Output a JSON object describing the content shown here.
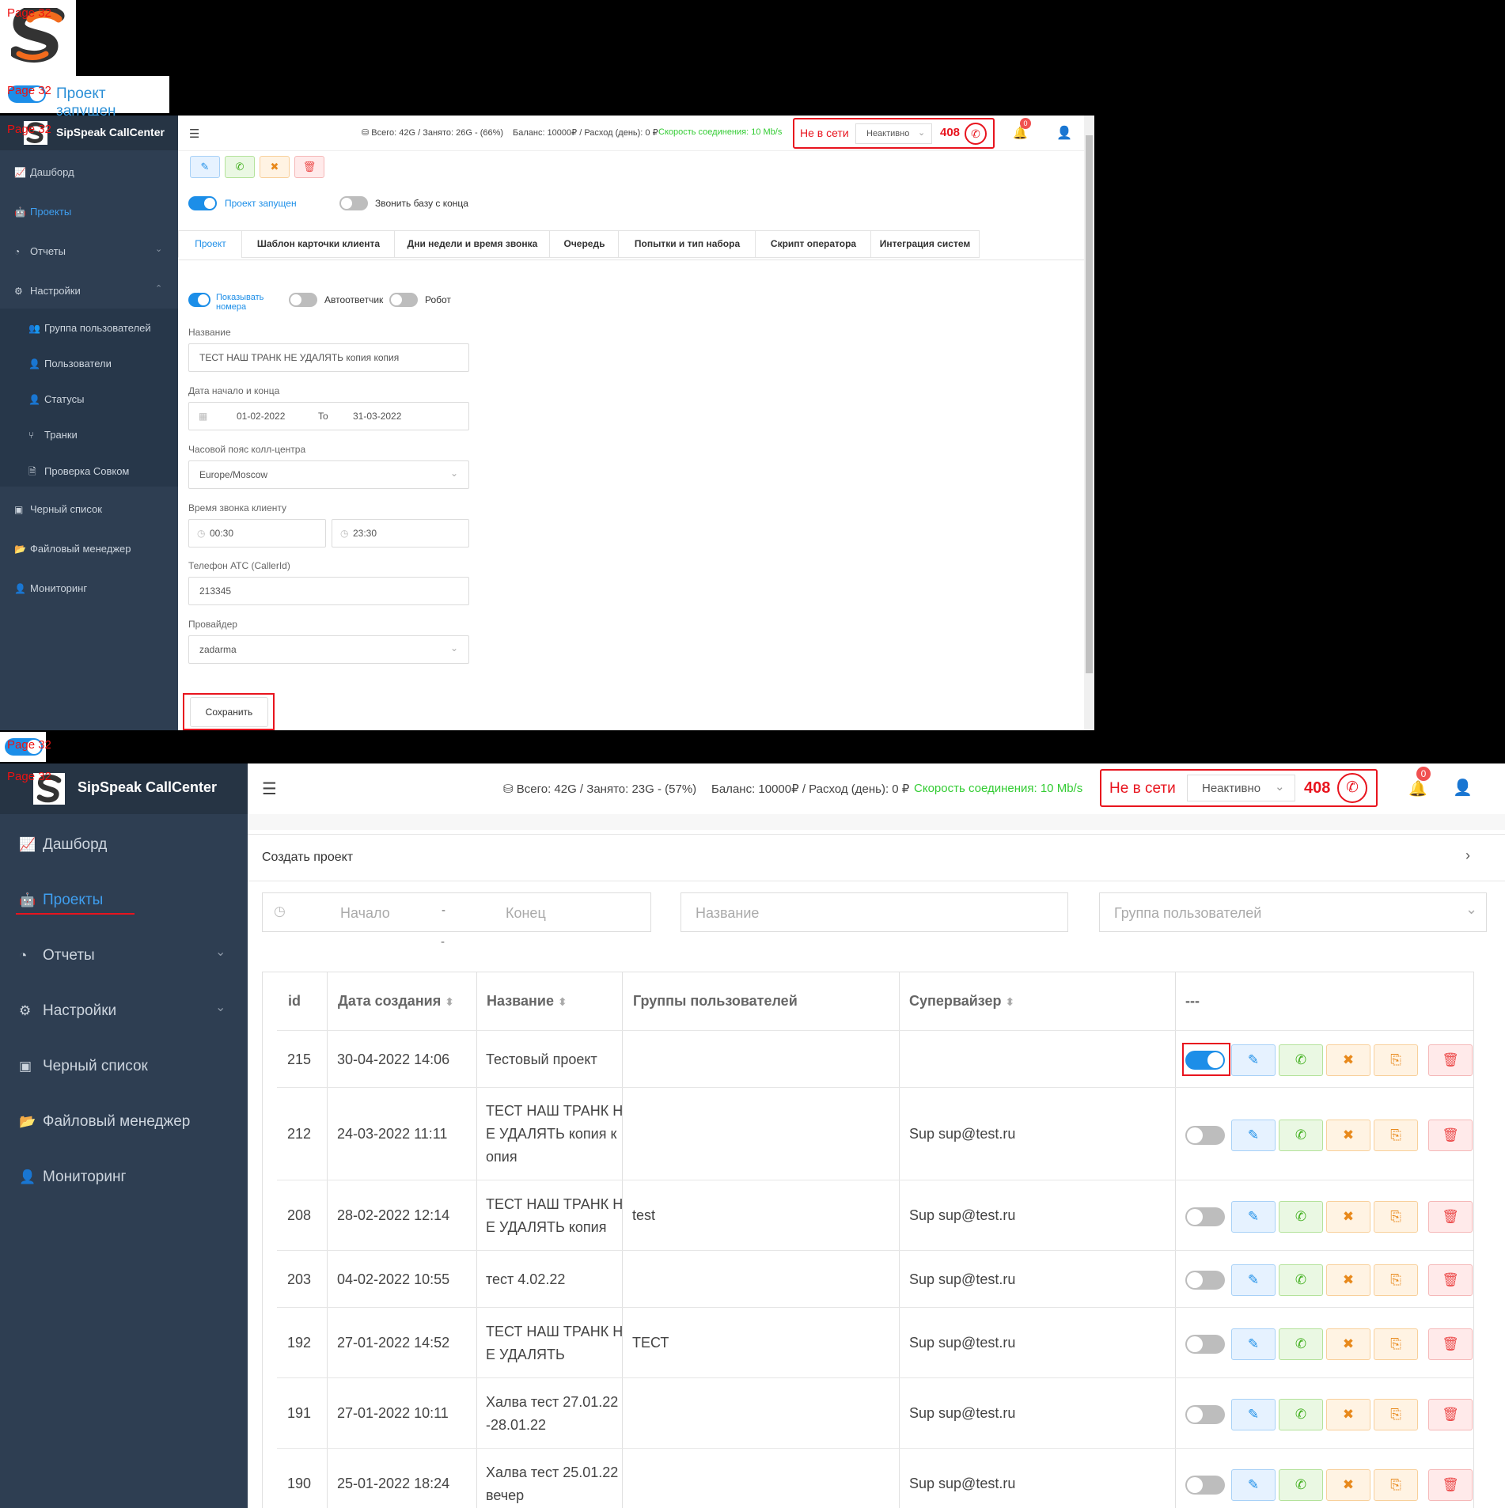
{
  "page_label": "Page 32",
  "logo": {
    "letter": "S"
  },
  "project_running_label": "Проект запущен",
  "colors": {
    "sidebar": "#2e3e52",
    "brand_bar": "#263444",
    "accent": "#1c8ee8",
    "offline_red": "#e8141e",
    "speed_green": "#33cc33"
  },
  "top": {
    "brand": "SipSpeak CallCenter",
    "nav": [
      {
        "label": "Дашборд",
        "icon": "chart-icon"
      },
      {
        "label": "Проекты",
        "icon": "robot-icon"
      },
      {
        "label": "Отчеты",
        "icon": "pie-chart-icon"
      },
      {
        "label": "Настройки",
        "icon": "gear-icon"
      },
      {
        "label": "Группа пользователей",
        "icon": "users-icon"
      },
      {
        "label": "Пользователи",
        "icon": "user-icon"
      },
      {
        "label": "Статусы",
        "icon": "user-status-icon"
      },
      {
        "label": "Транки",
        "icon": "sitemap-icon"
      },
      {
        "label": "Проверка Совком",
        "icon": "file-check-icon"
      },
      {
        "label": "Черный список",
        "icon": "blacklist-icon"
      },
      {
        "label": "Файловый менеджер",
        "icon": "folder-icon"
      },
      {
        "label": "Мониторинг",
        "icon": "monitor-user-icon"
      }
    ],
    "header": {
      "storage": "Всего: 42G / Занято: 26G - (66%)",
      "balance": "Баланс: 10000₽ / Расход (день): 0 ₽",
      "speed": "Скорость соединения: 10 Mb/s",
      "offline": "Не в сети",
      "status_select": "Неактивно",
      "ext": "408",
      "notif_count": "0"
    },
    "toggle_running": "Проект запущен",
    "toggle_reverse": "Звонить базу с конца",
    "tabs": [
      "Проект",
      "Шаблон карточки клиента",
      "Дни недели и время звонка",
      "Очередь",
      "Попытки и тип набора",
      "Скрипт оператора",
      "Интеграция систем"
    ],
    "toggle_show_numbers": "Показывать номера",
    "toggle_answering": "Автоответчик",
    "toggle_robot": "Робот",
    "form": {
      "name_label": "Название",
      "name_value": "ТЕСТ НАШ ТРАНК НЕ УДАЛЯТЬ копия копия",
      "dates_label": "Дата начало и конца",
      "date_start": "01-02-2022",
      "date_to": "To",
      "date_end": "31-03-2022",
      "tz_label": "Часовой пояс колл-центра",
      "tz_value": "Europe/Moscow",
      "call_time_label": "Время звонка клиенту",
      "time_from": "00:30",
      "time_to": "23:30",
      "callerid_label": "Телефон АТС (CallerId)",
      "callerid_value": "213345",
      "provider_label": "Провайдер",
      "provider_value": "zadarma",
      "save": "Сохранить"
    }
  },
  "bottom": {
    "brand": "SipSpeak CallCenter",
    "nav": [
      {
        "label": "Дашборд",
        "icon": "chart-icon"
      },
      {
        "label": "Проекты",
        "icon": "robot-icon"
      },
      {
        "label": "Отчеты",
        "icon": "pie-chart-icon"
      },
      {
        "label": "Настройки",
        "icon": "gear-icon"
      },
      {
        "label": "Черный список",
        "icon": "blacklist-icon"
      },
      {
        "label": "Файловый менеджер",
        "icon": "folder-icon"
      },
      {
        "label": "Мониторинг",
        "icon": "monitor-user-icon"
      }
    ],
    "header": {
      "storage": "Всего: 42G / Занято: 23G - (57%)",
      "balance": "Баланс: 10000₽ / Расход (день): 0 ₽",
      "speed": "Скорость соединения: 10 Mb/s",
      "offline": "Не в сети",
      "status_select": "Неактивно",
      "ext": "408",
      "notif_count": "0"
    },
    "create_project": "Создать проект",
    "filters": {
      "start": "Начало",
      "dash": "-",
      "end": "Конец",
      "name": "Название",
      "group": "Группа пользователей"
    },
    "table": {
      "headers": [
        "id",
        "Дата создания",
        "Название",
        "Группы пользователей",
        "Супервайзер",
        "---"
      ],
      "rows": [
        {
          "id": "215",
          "date": "30-04-2022 14:06",
          "name": [
            "Тестовый проект"
          ],
          "group": "",
          "sup": "",
          "on": true
        },
        {
          "id": "212",
          "date": "24-03-2022 11:11",
          "name": [
            "ТЕСТ НАШ ТРАНК Н",
            "Е УДАЛЯТЬ копия к",
            "опия"
          ],
          "group": "",
          "sup": "Sup sup@test.ru",
          "on": false
        },
        {
          "id": "208",
          "date": "28-02-2022 12:14",
          "name": [
            "ТЕСТ НАШ ТРАНК Н",
            "Е УДАЛЯТЬ копия"
          ],
          "group": "test",
          "sup": "Sup sup@test.ru",
          "on": false
        },
        {
          "id": "203",
          "date": "04-02-2022 10:55",
          "name": [
            "тест 4.02.22"
          ],
          "group": "",
          "sup": "Sup sup@test.ru",
          "on": false
        },
        {
          "id": "192",
          "date": "27-01-2022 14:52",
          "name": [
            "ТЕСТ НАШ ТРАНК Н",
            "Е УДАЛЯТЬ"
          ],
          "group": "ТЕСТ",
          "sup": "Sup sup@test.ru",
          "on": false
        },
        {
          "id": "191",
          "date": "27-01-2022 10:11",
          "name": [
            "Халва тест 27.01.22",
            "-28.01.22"
          ],
          "group": "",
          "sup": "Sup sup@test.ru",
          "on": false
        },
        {
          "id": "190",
          "date": "25-01-2022 18:24",
          "name": [
            "Халва тест 25.01.22",
            "вечер"
          ],
          "group": "",
          "sup": "Sup sup@test.ru",
          "on": false
        }
      ]
    }
  }
}
